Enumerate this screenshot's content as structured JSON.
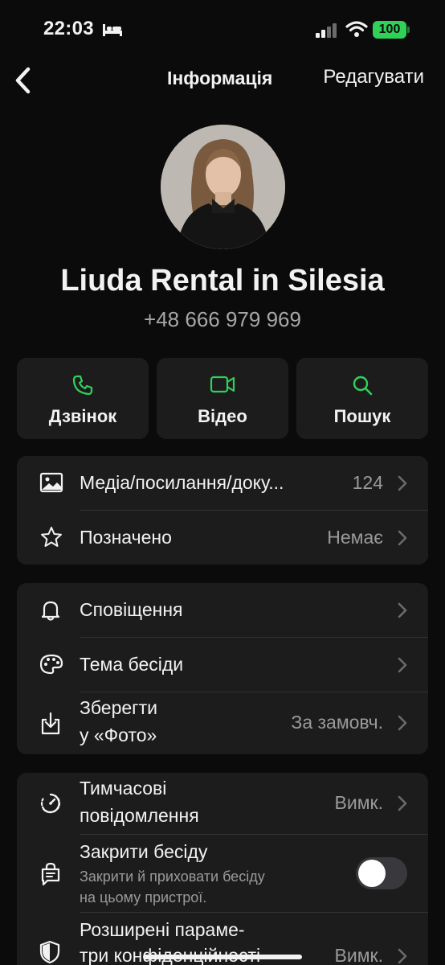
{
  "status_bar": {
    "time": "22:03",
    "battery": "100",
    "icons": [
      "bed-icon",
      "signal-icon",
      "wifi-icon"
    ],
    "battery_color": "#30d158"
  },
  "nav": {
    "back_icon": "chevron-left-icon",
    "title": "Інформація",
    "edit_label": "Редагувати"
  },
  "contact": {
    "name": "Liuda Rental in Silesia",
    "phone": "+48 666 979 969"
  },
  "actions": [
    {
      "label": "Дзвінок",
      "icon": "phone-icon"
    },
    {
      "label": "Відео",
      "icon": "video-icon"
    },
    {
      "label": "Пошук",
      "icon": "search-icon"
    }
  ],
  "accent_color": "#30d158",
  "group1": [
    {
      "label": "Медіа/посилання/доку...",
      "value": "124",
      "icon": "photo-icon"
    },
    {
      "label": "Позначено",
      "value": "Немає",
      "icon": "star-icon"
    }
  ],
  "group2": [
    {
      "label": "Сповіщення",
      "value": "",
      "icon": "bell-icon"
    },
    {
      "label": "Тема бесіди",
      "value": "",
      "icon": "palette-icon"
    },
    {
      "label_line1": "Зберегти",
      "label_line2": "у «Фото»",
      "value": "За замовч.",
      "icon": "download-icon"
    }
  ],
  "group3": {
    "disappearing": {
      "label_line1": "Тимчасові",
      "label_line2": "повідомлення",
      "value": "Вимк.",
      "icon": "timer-icon"
    },
    "lock_chat": {
      "label": "Закрити бесіду",
      "sub_line1": "Закрити й приховати бесіду",
      "sub_line2": "на цьому пристрої.",
      "toggle_on": false,
      "icon": "lock-chat-icon"
    },
    "privacy": {
      "label_line1": "Розширені параме-",
      "label_line2": "три конфіденційності",
      "value": "Вимк.",
      "icon": "shield-icon"
    }
  }
}
